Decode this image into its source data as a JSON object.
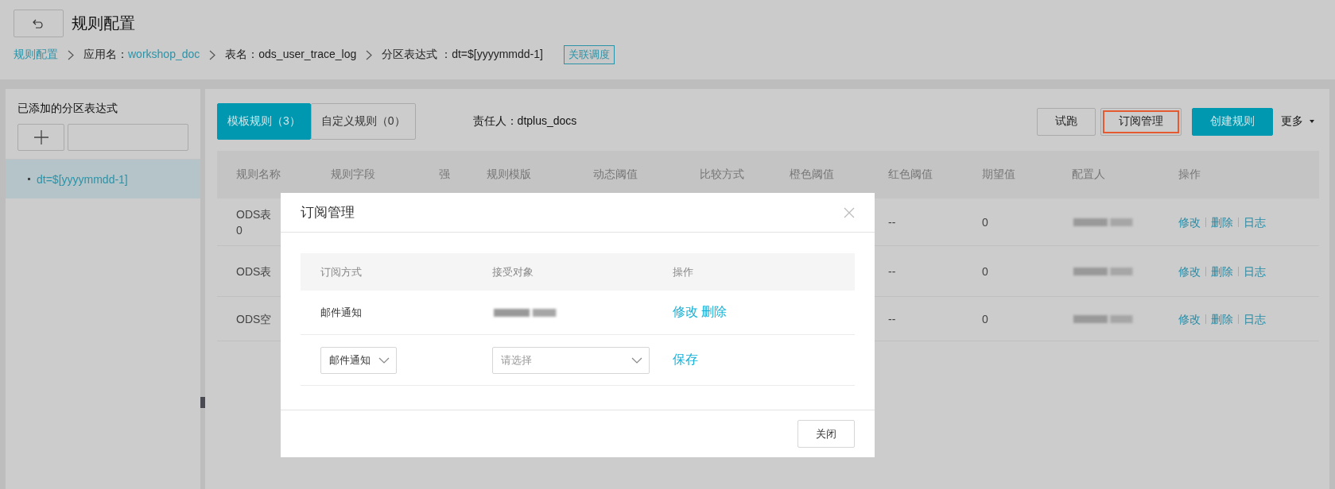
{
  "header": {
    "title": "规则配置",
    "breadcrumb": [
      {
        "parts": [
          {
            "text": "规则配置",
            "link": true
          }
        ]
      },
      {
        "parts": [
          {
            "text": "应用名：",
            "link": false
          },
          {
            "text": "workshop_doc",
            "link": true
          }
        ]
      },
      {
        "parts": [
          {
            "text": "表名：ods_user_trace_log",
            "link": false
          }
        ]
      },
      {
        "parts": [
          {
            "text": "分区表达式 ：dt=$[yyyymmdd-1]",
            "link": false
          }
        ]
      }
    ],
    "tag": "关联调度"
  },
  "sidebar": {
    "title": "已添加的分区表达式",
    "items": [
      {
        "label": "dt=$[yyyymmdd-1]",
        "selected": true
      }
    ]
  },
  "tabs": [
    {
      "label": "模板规则（3）",
      "selected": true
    },
    {
      "label": "自定义规则（0）",
      "selected": false
    }
  ],
  "owner": "责任人：dtplus_docs",
  "actions": [
    {
      "label": "试跑",
      "kind": "default",
      "highlighted": false
    },
    {
      "label": "订阅管理",
      "kind": "default",
      "highlighted": true
    },
    {
      "label": "创建规则",
      "kind": "primary",
      "highlighted": false
    }
  ],
  "more": "更多",
  "table": {
    "columns": [
      "规则名称",
      "规则字段",
      "强",
      "规则模版",
      "动态阈值",
      "比较方式",
      "橙色阈值",
      "红色阈值",
      "期望值",
      "配置人",
      "操作"
    ],
    "rows": [
      {
        "name": [
          "ODS表",
          "0"
        ],
        "red": "--",
        "expected": "0",
        "links": [
          "修改",
          "删除",
          "日志"
        ]
      },
      {
        "name": [
          "ODS表"
        ],
        "red": "--",
        "expected": "0",
        "links": [
          "修改",
          "删除",
          "日志"
        ]
      },
      {
        "name": [
          "ODS空"
        ],
        "red": "--",
        "expected": "0",
        "links": [
          "修改",
          "删除",
          "日志"
        ]
      }
    ]
  },
  "dialog": {
    "title": "订阅管理",
    "columns": [
      "订阅方式",
      "接受对象",
      "操作"
    ],
    "rows": [
      {
        "method": "邮件通知",
        "links": [
          "修改",
          "删除"
        ]
      }
    ],
    "new_row": {
      "method": "邮件通知",
      "recipient_placeholder": "请选择",
      "save": "保存"
    },
    "close": "关闭"
  }
}
